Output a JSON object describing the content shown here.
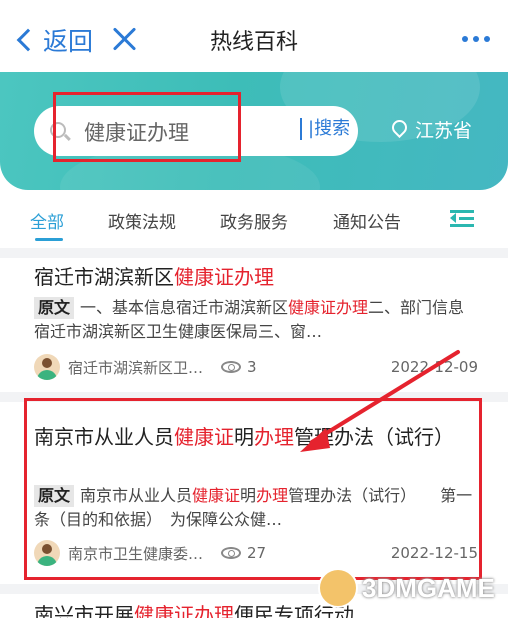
{
  "header": {
    "back_label": "返回",
    "title": "热线百科"
  },
  "search": {
    "query": "健康证办理",
    "button_label": "|搜索",
    "location": "江苏省"
  },
  "tabs": [
    {
      "label": "全部",
      "active": true
    },
    {
      "label": "政策法规",
      "active": false
    },
    {
      "label": "政务服务",
      "active": false
    },
    {
      "label": "通知公告",
      "active": false
    }
  ],
  "articles": [
    {
      "title_plain": "宿迁市湖滨新区",
      "title_hl": "健康证办理",
      "tag": "原文",
      "body_pre": "一、基本信息宿迁市湖滨新区",
      "body_hl": "健康证办理",
      "body_post": "二、部门信息宿迁市湖滨新区卫生健康医保局三、窗…",
      "source": "宿迁市湖滨新区卫…",
      "views": "3",
      "date": "2022-12-09"
    },
    {
      "title_a": "南京市从业人员",
      "title_hl1": "健康证",
      "title_b": "明",
      "title_hl2": "办理",
      "title_c": "管理办法（试行）",
      "tag": "原文",
      "body_a": "南京市从业人员",
      "body_hl1": "健康证",
      "body_b": "明",
      "body_hl2": "办理",
      "body_c": "管理办法（试行）　　第一条（目的和依据）　为保障公众健…",
      "source": "南京市卫生健康委…",
      "views": "27",
      "date": "2022-12-15"
    },
    {
      "title_a": "南兴市开展",
      "title_hl": "健康证办理",
      "title_b": "便民专项行动"
    }
  ],
  "watermark": "3DMGAME",
  "colors": {
    "accent_blue": "#2b7ad6",
    "teal": "#3dbdb8",
    "highlight_red": "#e5232e"
  }
}
